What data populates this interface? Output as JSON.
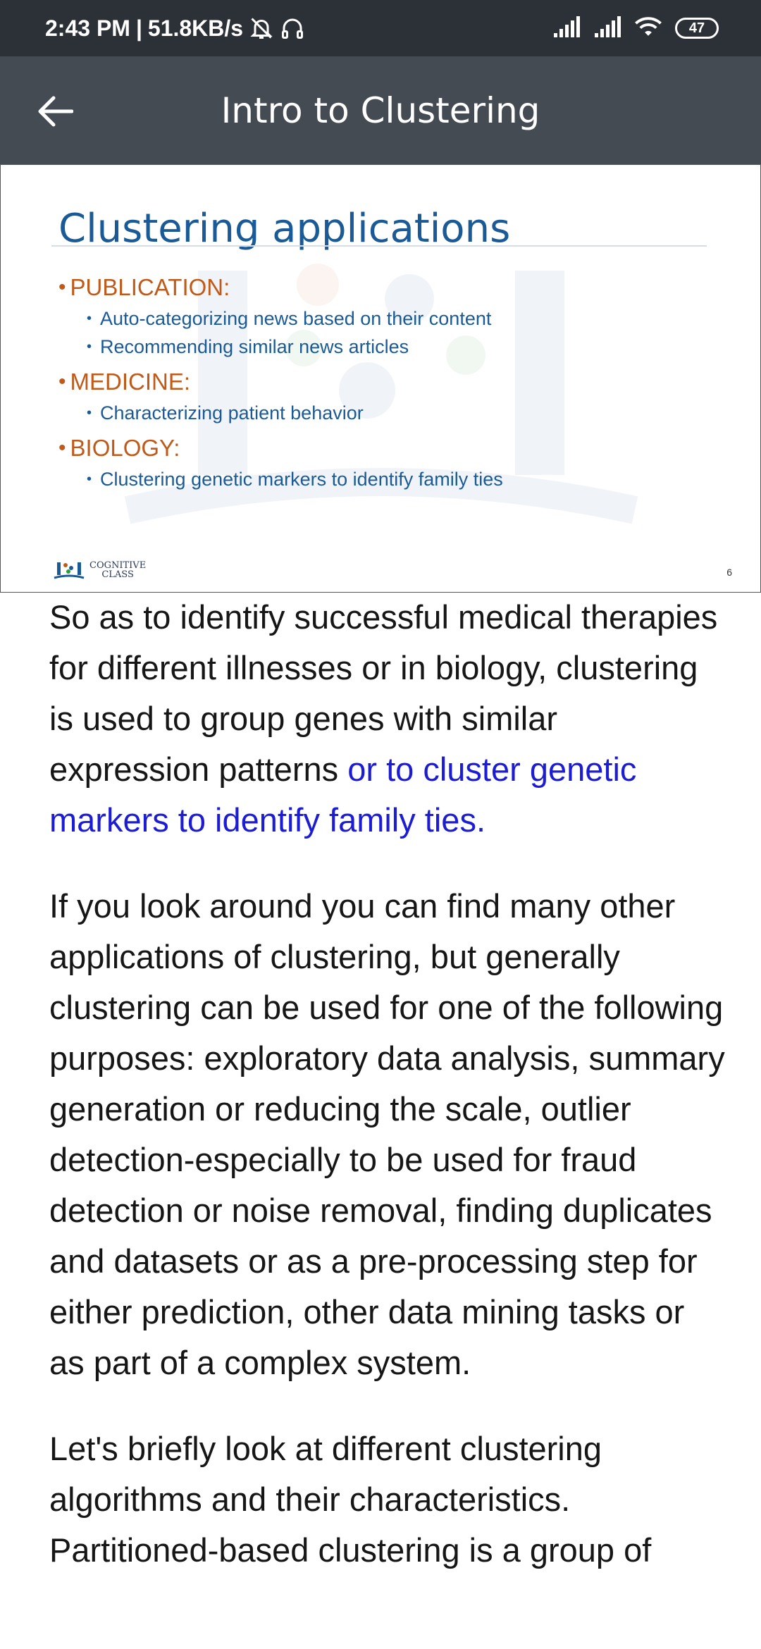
{
  "status_bar": {
    "time": "2:43 PM",
    "network_speed": "51.8KB/s",
    "icons": [
      "muted-bell-icon",
      "headphones-icon",
      "signal-icon",
      "signal-icon",
      "wifi-icon"
    ],
    "battery": "47"
  },
  "app_bar": {
    "title": "Intro to Clustering",
    "back_icon": "arrow-left-icon"
  },
  "slide": {
    "heading": "Clustering applications",
    "categories": [
      {
        "label": "PUBLICATION:",
        "items": [
          "Auto-categorizing news based on their content",
          "Recommending similar news articles"
        ]
      },
      {
        "label": "MEDICINE:",
        "items": [
          "Characterizing patient behavior"
        ]
      },
      {
        "label": "BIOLOGY:",
        "items": [
          "Clustering genetic markers to identify family ties"
        ]
      }
    ],
    "logo_line1": "COGNITIVE",
    "logo_line2": "CLASS",
    "page_number": "6",
    "colors": {
      "heading": "#1a5a96",
      "category": "#c05a1a",
      "item": "#1a5a96"
    }
  },
  "transcript": {
    "p1_text": "So as to identify successful medical therapies for different illnesses or in biology, clustering is used to group genes with similar expression patterns ",
    "p1_highlight": "or to cluster genetic markers to identify family ties.",
    "p2": "If you look around you can find many other applications of clustering, but generally clustering can be used for one of the following purposes: exploratory data analysis, summary generation or reducing the scale, outlier detection-especially to be used for fraud detection or noise removal, finding duplicates and datasets or as a pre-processing step for either prediction, other data mining tasks or as part of a complex system.",
    "p3": "Let's briefly look at different clustering algorithms and their characteristics. Partitioned-based clustering is a group of",
    "highlight_color": "#1c1cd4"
  }
}
